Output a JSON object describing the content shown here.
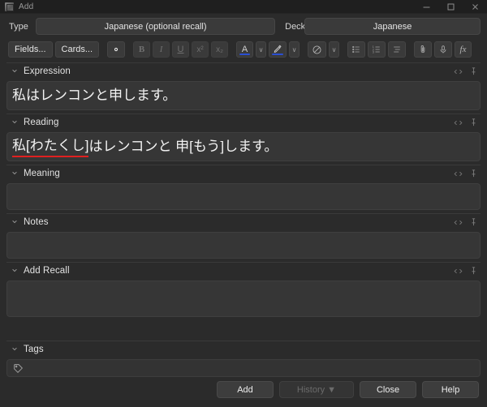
{
  "window": {
    "title": "Add",
    "icon": "anki-app-icon",
    "controls": {
      "minimize": "minimize-icon",
      "maximize": "maximize-icon",
      "close": "close-icon"
    }
  },
  "notetype_row": {
    "type_label": "Type",
    "type_value": "Japanese (optional recall)",
    "deck_label": "Deck",
    "deck_value": "Japanese"
  },
  "toolbar": {
    "fields_label": "Fields...",
    "cards_label": "Cards...",
    "settings_icon": "gear-icon",
    "bold_label": "B",
    "italic_label": "I",
    "underline_label": "U",
    "superscript_label": "x²",
    "subscript_label": "x₂",
    "text_color_label": "A",
    "text_color_caret": "∨",
    "highlight_icon": "highlighter-icon",
    "highlight_caret": "∨",
    "remove_format_icon": "eraser-icon",
    "remove_format_caret": "∨",
    "bullet_list_icon": "bulleted-list-icon",
    "numbered_list_icon": "numbered-list-icon",
    "justify_icon": "align-icon",
    "attach_icon": "paperclip-icon",
    "record_icon": "microphone-icon",
    "equation_label": "fx",
    "accent_color": "#2a4fd4"
  },
  "fields": [
    {
      "name": "Expression",
      "value": "私はレンコンと申します。",
      "spell_error": "",
      "size": "text",
      "html_icon": "code-icon",
      "pin_icon": "pin-icon",
      "collapse_icon": "chevron-down-icon"
    },
    {
      "name": "Reading",
      "value": "はレンコンと 申[もう]します。",
      "spell_error": "私[わたくし]",
      "size": "text",
      "html_icon": "code-icon",
      "pin_icon": "pin-icon",
      "collapse_icon": "chevron-down-icon"
    },
    {
      "name": "Meaning",
      "value": "",
      "spell_error": "",
      "size": "empty",
      "html_icon": "code-icon",
      "pin_icon": "pin-icon",
      "collapse_icon": "chevron-down-icon"
    },
    {
      "name": "Notes",
      "value": "",
      "spell_error": "",
      "size": "empty",
      "html_icon": "code-icon",
      "pin_icon": "pin-icon",
      "collapse_icon": "chevron-down-icon"
    },
    {
      "name": "Add Recall",
      "value": "",
      "spell_error": "",
      "size": "tall",
      "html_icon": "code-icon",
      "pin_icon": "pin-icon",
      "collapse_icon": "chevron-down-icon"
    }
  ],
  "tags": {
    "label": "Tags",
    "value": "",
    "icon": "tag-icon",
    "collapse_icon": "chevron-down-icon"
  },
  "buttons": {
    "add": "Add",
    "history": "History ▼",
    "close": "Close",
    "help": "Help",
    "history_disabled": true
  }
}
